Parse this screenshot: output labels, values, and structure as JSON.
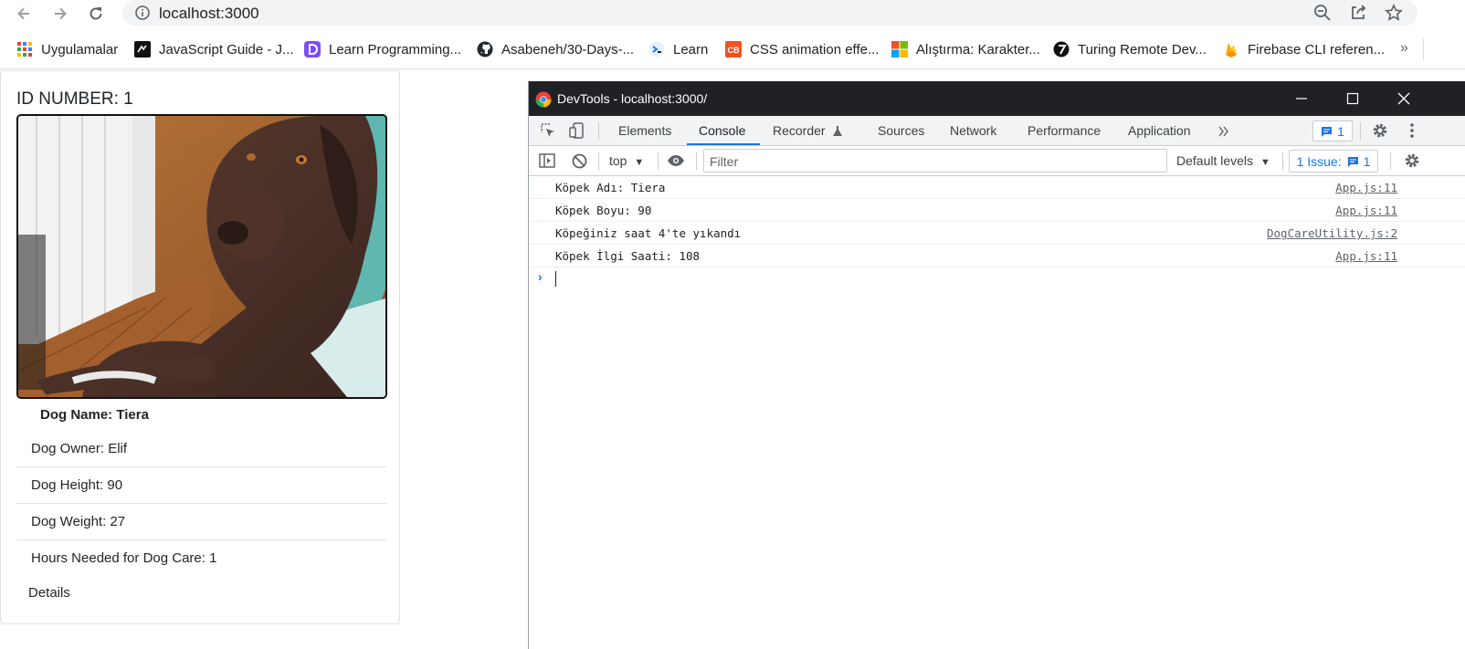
{
  "browser": {
    "url": "localhost:3000",
    "bookmarks": [
      {
        "label": "Uygulamalar",
        "icon": "apps-grid-icon"
      },
      {
        "label": "JavaScript Guide - J...",
        "icon": "javascript-guide-icon"
      },
      {
        "label": "Learn Programming...",
        "icon": "learn-programming-icon"
      },
      {
        "label": "Asabeneh/30-Days-...",
        "icon": "github-icon"
      },
      {
        "label": "Learn",
        "icon": "microsoft-learn-icon"
      },
      {
        "label": "CSS animation effe...",
        "icon": "css-animation-icon"
      },
      {
        "label": "Alıştırma: Karakter...",
        "icon": "microsoft-icon"
      },
      {
        "label": "Turing Remote Dev...",
        "icon": "turing-icon"
      },
      {
        "label": "Firebase CLI referen...",
        "icon": "firebase-icon"
      }
    ],
    "more_label": "»"
  },
  "card": {
    "id_title": "ID NUMBER: 1",
    "dog_name": "Dog Name: Tiera",
    "rows": [
      "Dog Owner: Elif",
      "Dog Height: 90",
      "Dog Weight: 27",
      "Hours Needed for Dog Care: 1"
    ],
    "details_label": "Details"
  },
  "devtools": {
    "title": "DevTools - localhost:3000/",
    "tabs": [
      "Elements",
      "Console",
      "Recorder",
      "Sources",
      "Network",
      "Performance",
      "Application"
    ],
    "selected_tab": "Console",
    "issues_count": "1",
    "context": "top",
    "filter_placeholder": "Filter",
    "levels": "Default levels",
    "issues_label": "1 Issue:",
    "issues_label_count": "1",
    "logs": [
      {
        "message": "Köpek Adı: Tiera",
        "source": "App.js:11"
      },
      {
        "message": "Köpek Boyu: 90",
        "source": "App.js:11"
      },
      {
        "message": "Köpeğiniz saat 4'te yıkandı",
        "source": "DogCareUtility.js:2"
      },
      {
        "message": "Köpek İlgi Saati: 108",
        "source": "App.js:11"
      }
    ],
    "accent": "#1a73e8"
  }
}
